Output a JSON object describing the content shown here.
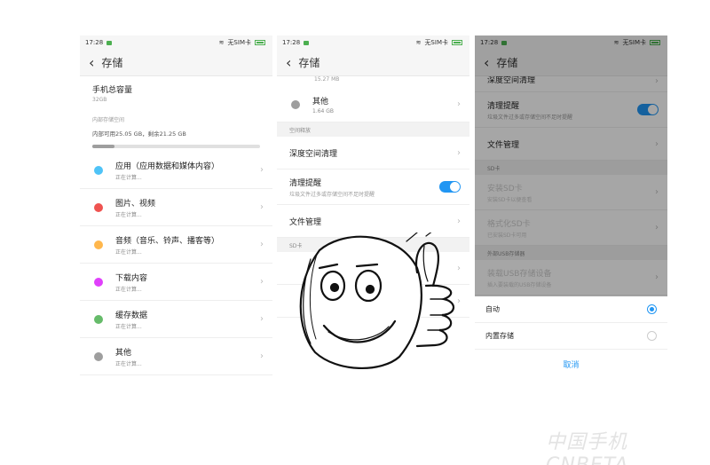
{
  "status_bar": {
    "time": "17:28",
    "carrier": "无SIM卡"
  },
  "screen1": {
    "title": "存储",
    "total_label": "手机总容量",
    "total_value": "32GB",
    "section_internal": "内部存储空间",
    "internal_stats": "内部可用25.05 GB，剩余21.25 GB",
    "usage_fraction": 0.13,
    "items": [
      {
        "name": "应用（应用数据和媒体内容）",
        "sub": "正在计算...",
        "color": "#4fc3f7"
      },
      {
        "name": "图片、视频",
        "sub": "正在计算...",
        "color": "#ef5350"
      },
      {
        "name": "音频（音乐、铃声、播客等）",
        "sub": "正在计算...",
        "color": "#ffb74d"
      },
      {
        "name": "下载内容",
        "sub": "正在计算...",
        "color": "#e040fb"
      },
      {
        "name": "缓存数据",
        "sub": "正在计算...",
        "color": "#66bb6a"
      },
      {
        "name": "其他",
        "sub": "正在计算...",
        "color": "#9e9e9e"
      }
    ]
  },
  "screen2": {
    "title": "存储",
    "top_partial": "15.27 MB",
    "other_name": "其他",
    "other_size": "1.64 GB",
    "section_space": "空间释放",
    "deep_clean": "深度空间清理",
    "clean_reminder": "清理提醒",
    "clean_reminder_sub": "垃圾文件过多或存储空间不足时提醒",
    "file_mgmt": "文件管理",
    "section_sd": "SD卡"
  },
  "screen3": {
    "title": "存储",
    "deep_clean": "深度空间清理",
    "clean_reminder": "清理提醒",
    "clean_reminder_sub": "垃圾文件过多或存储空间不足时提醒",
    "file_mgmt": "文件管理",
    "section_sd": "SD卡",
    "install_sd": "安装SD卡",
    "install_sd_sub": "安装SD卡以便查看",
    "format_sd": "格式化SD卡",
    "format_sd_sub": "已安装SD卡可用",
    "section_usb": "外部USB存储器",
    "mount_usb": "装载USB存储设备",
    "mount_usb_sub": "插入要装载的USB存储设备",
    "options": [
      {
        "label": "自动",
        "selected": true
      },
      {
        "label": "内置存储",
        "selected": false
      }
    ],
    "cancel": "取消"
  },
  "watermark": "中国手机 CNBETA"
}
